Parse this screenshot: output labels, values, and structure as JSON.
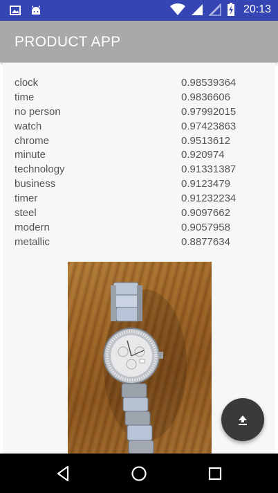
{
  "status_bar": {
    "time": "20:13",
    "icons": [
      "image-icon",
      "android-icon",
      "wifi-icon",
      "signal-icon",
      "signal-empty-icon",
      "battery-charging-icon"
    ]
  },
  "app_bar": {
    "title": "PRODUCT APP",
    "color": "#a9a9a9"
  },
  "tags": [
    {
      "label": "clock",
      "score": "0.98539364"
    },
    {
      "label": "time",
      "score": "0.9836606"
    },
    {
      "label": "no person",
      "score": "0.97992015"
    },
    {
      "label": "watch",
      "score": "0.97423863"
    },
    {
      "label": "chrome",
      "score": "0.9513612"
    },
    {
      "label": "minute",
      "score": "0.920974"
    },
    {
      "label": "technology",
      "score": "0.91331387"
    },
    {
      "label": "business",
      "score": "0.9123479"
    },
    {
      "label": "timer",
      "score": "0.91232234"
    },
    {
      "label": "steel",
      "score": "0.9097662"
    },
    {
      "label": "modern",
      "score": "0.9057958"
    },
    {
      "label": "metallic",
      "score": "0.8877634"
    }
  ],
  "fab": {
    "icon": "upload-icon",
    "color": "#3a3a3a"
  },
  "nav_bar": {
    "buttons": [
      "back-icon",
      "home-icon",
      "recents-icon"
    ]
  },
  "colors": {
    "status_bar": "#3645b4",
    "background": "#f7f7f7",
    "text": "#555555"
  }
}
